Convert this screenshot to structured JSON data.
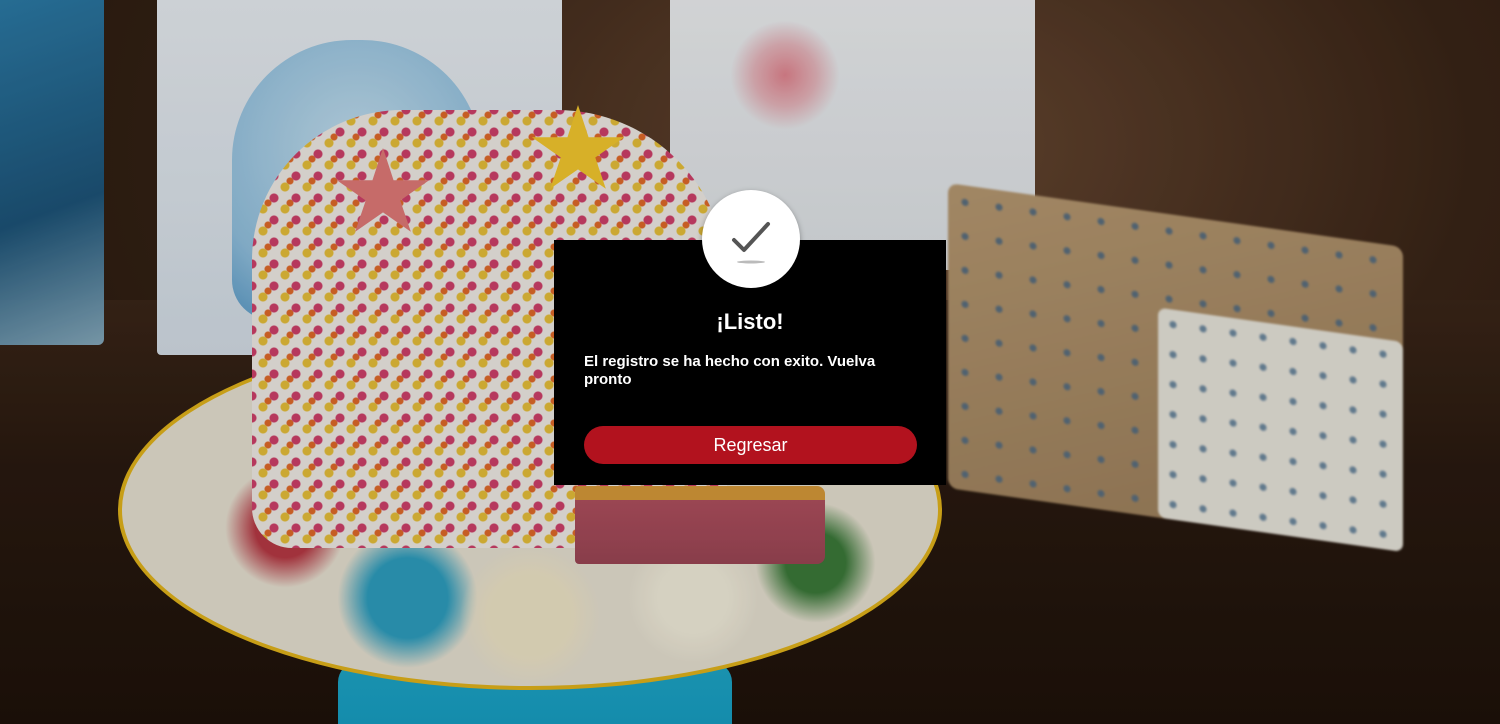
{
  "dialog": {
    "icon": "checkmark-icon",
    "title": "¡Listo!",
    "message": "El registro se ha hecho con exito. Vuelva pronto",
    "button_label": "Regresar"
  },
  "colors": {
    "dialog_background": "#000000",
    "button_background": "#b2121e",
    "text": "#ffffff"
  }
}
